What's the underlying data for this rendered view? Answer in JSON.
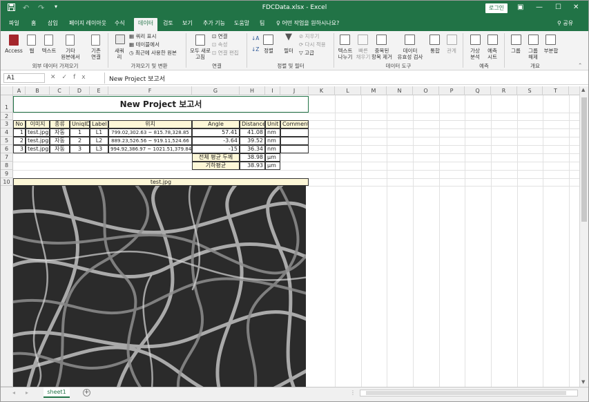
{
  "titlebar": {
    "doc_title": "FDCData.xlsx - Excel",
    "login_label": "로그인",
    "save_icon": "save-icon",
    "undo_icon": "undo-icon",
    "redo_icon": "redo-icon"
  },
  "tabs": [
    "파일",
    "홈",
    "삽입",
    "페이지 레이아웃",
    "수식",
    "데이터",
    "검토",
    "보기",
    "추가 기능",
    "도움말",
    "팀"
  ],
  "active_tab": "데이터",
  "tell_me": "어떤 작업을 원하시나요?",
  "share_label": "공유",
  "ribbon": {
    "access": "Access",
    "web": "웹",
    "text": "텍스트",
    "other": "기타",
    "other2": "원본에서",
    "existing": "기존",
    "existing2": "연결",
    "group1": "외부 데이터 가져오기",
    "new_query": "새쿼",
    "new_query2": "리",
    "query_show": "쿼리 표시",
    "from_table": "테이블에서",
    "recent_source": "최근에 사용한 원본",
    "group2": "가져오기 및 변환",
    "refresh_all": "모두 새로",
    "refresh_all2": "고침",
    "connections": "연결",
    "properties": "속성",
    "edit_links": "연결 편집",
    "group3": "연결",
    "sort": "정렬",
    "filter": "필터",
    "clear": "지우기",
    "reapply": "다시 적용",
    "advanced": "고급",
    "group4": "정렬 및 필터",
    "text_to_cols": "텍스트",
    "text_to_cols2": "나누기",
    "flash_fill": "빠른",
    "flash_fill2": "채우기",
    "remove_dup": "중복된",
    "remove_dup2": "항목 제거",
    "validation": "데이터",
    "validation2": "유효성 검사",
    "consolidate": "통합",
    "relationships": "관계",
    "group5": "데이터 도구",
    "what_if": "가상",
    "what_if2": "분석",
    "forecast": "예측",
    "forecast2": "시트",
    "group6": "예측",
    "group_btn": "그룹",
    "ungroup": "그룹",
    "ungroup2": "해제",
    "subtotal": "부분합",
    "group7": "개요"
  },
  "formula_bar": {
    "name_box": "A1",
    "formula": "New Project 보고서"
  },
  "columns": [
    "A",
    "B",
    "C",
    "D",
    "E",
    "F",
    "G",
    "H",
    "I",
    "J",
    "K",
    "L",
    "M",
    "N",
    "O",
    "P",
    "Q",
    "R",
    "S",
    "T"
  ],
  "rows": [
    "1",
    "2",
    "3",
    "4",
    "5",
    "6",
    "7",
    "8",
    "9",
    "10"
  ],
  "sheet": {
    "title": "New Project 보고서",
    "headers": [
      "No",
      "이미지",
      "종류",
      "UniqID",
      "Label",
      "위치",
      "Angle",
      "Distance",
      "Unit",
      "Comment"
    ],
    "data_rows": [
      [
        "1",
        "test.jpg",
        "자동",
        "1",
        "L1",
        "799.02,302.63 ~ 815.78,328.85",
        "57.41",
        "41.08",
        "nm",
        ""
      ],
      [
        "2",
        "test.jpg",
        "자동",
        "2",
        "L2",
        "889.23,526.56 ~ 919.11,524.66",
        "-3.64",
        "39.52",
        "nm",
        ""
      ],
      [
        "3",
        "test.jpg",
        "자동",
        "3",
        "L3",
        "994.92,386.97 ~ 1021.51,379.84",
        "-15",
        "36.34",
        "nm",
        ""
      ]
    ],
    "summary": [
      {
        "label": "전체 평균 두께",
        "value": "38.98",
        "unit": "µm"
      },
      {
        "label": "기하평균",
        "value": "38.93",
        "unit": "µm"
      }
    ],
    "image_label": "test.jpg"
  },
  "sheet_tab": "sheet1"
}
